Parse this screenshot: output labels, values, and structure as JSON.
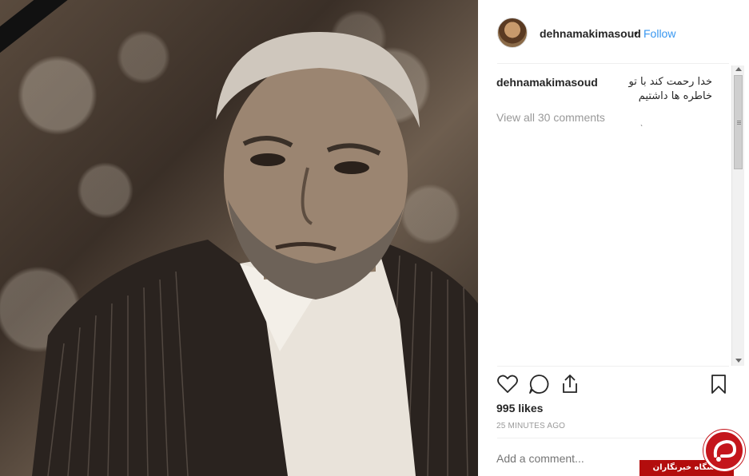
{
  "post": {
    "username": "dehnamakimasoud",
    "follow_label": "Follow",
    "separator": "•",
    "caption_text": "خدا رحمت کند با تو خاطره ها داشتیم",
    "view_all_comments": "View all 30 comments",
    "likes": "995 likes",
    "timestamp": "25 MINUTES AGO",
    "add_comment_placeholder": "Add a comment..."
  },
  "watermark": {
    "text": "باشگاه خبرنگاران"
  },
  "colors": {
    "follow_blue": "#3897f0",
    "watermark_red": "#c4161c"
  },
  "icons": {
    "like": "heart-icon",
    "comment": "comment-bubble-icon",
    "share": "share-icon",
    "save": "bookmark-icon"
  }
}
